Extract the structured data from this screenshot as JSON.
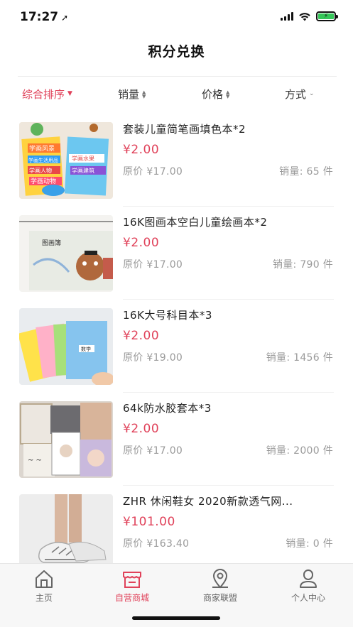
{
  "status_bar": {
    "time": "17:27",
    "battery_icon": "battery-charging-icon"
  },
  "header": {
    "title": "积分兑换"
  },
  "sort_bar": {
    "items": [
      {
        "label": "综合排序",
        "active": true,
        "icon": "caret-down-icon"
      },
      {
        "label": "销量",
        "active": false,
        "icon": "sort-updown-icon"
      },
      {
        "label": "价格",
        "active": false,
        "icon": "sort-updown-icon"
      },
      {
        "label": "方式",
        "active": false,
        "icon": "chevron-down-icon"
      }
    ]
  },
  "products": [
    {
      "title": "套装儿童简笔画填色本*2",
      "price": "¥2.00",
      "original": "原价 ¥17.00",
      "sales": "销量: 65 件"
    },
    {
      "title": "16K图画本空白儿童绘画本*2",
      "price": "¥2.00",
      "original": "原价 ¥17.00",
      "sales": "销量: 790 件"
    },
    {
      "title": "16K大号科目本*3",
      "price": "¥2.00",
      "original": "原价 ¥19.00",
      "sales": "销量: 1456 件"
    },
    {
      "title": "64k防水胶套本*3",
      "price": "¥2.00",
      "original": "原价 ¥17.00",
      "sales": "销量: 2000 件"
    },
    {
      "title": "ZHR 休闲鞋女 2020新款透气网...",
      "price": "¥101.00",
      "original": "原价 ¥163.40",
      "sales": "销量: 0 件"
    }
  ],
  "tab_bar": {
    "tabs": [
      {
        "label": "主页",
        "icon": "home-icon",
        "active": false
      },
      {
        "label": "自营商城",
        "icon": "store-icon",
        "active": true
      },
      {
        "label": "商家联盟",
        "icon": "location-pin-icon",
        "active": false
      },
      {
        "label": "个人中心",
        "icon": "user-icon",
        "active": false
      }
    ]
  },
  "colors": {
    "accent": "#e0425a",
    "muted": "#9a9a9a",
    "tab_bg": "#f7f7f7"
  },
  "image_text": {
    "p1": [
      "学画风景",
      "学画生活用品",
      "学画水果",
      "学画人物",
      "学画动物",
      "学画建筑"
    ],
    "p2": "图画簿",
    "p3": "数学"
  }
}
